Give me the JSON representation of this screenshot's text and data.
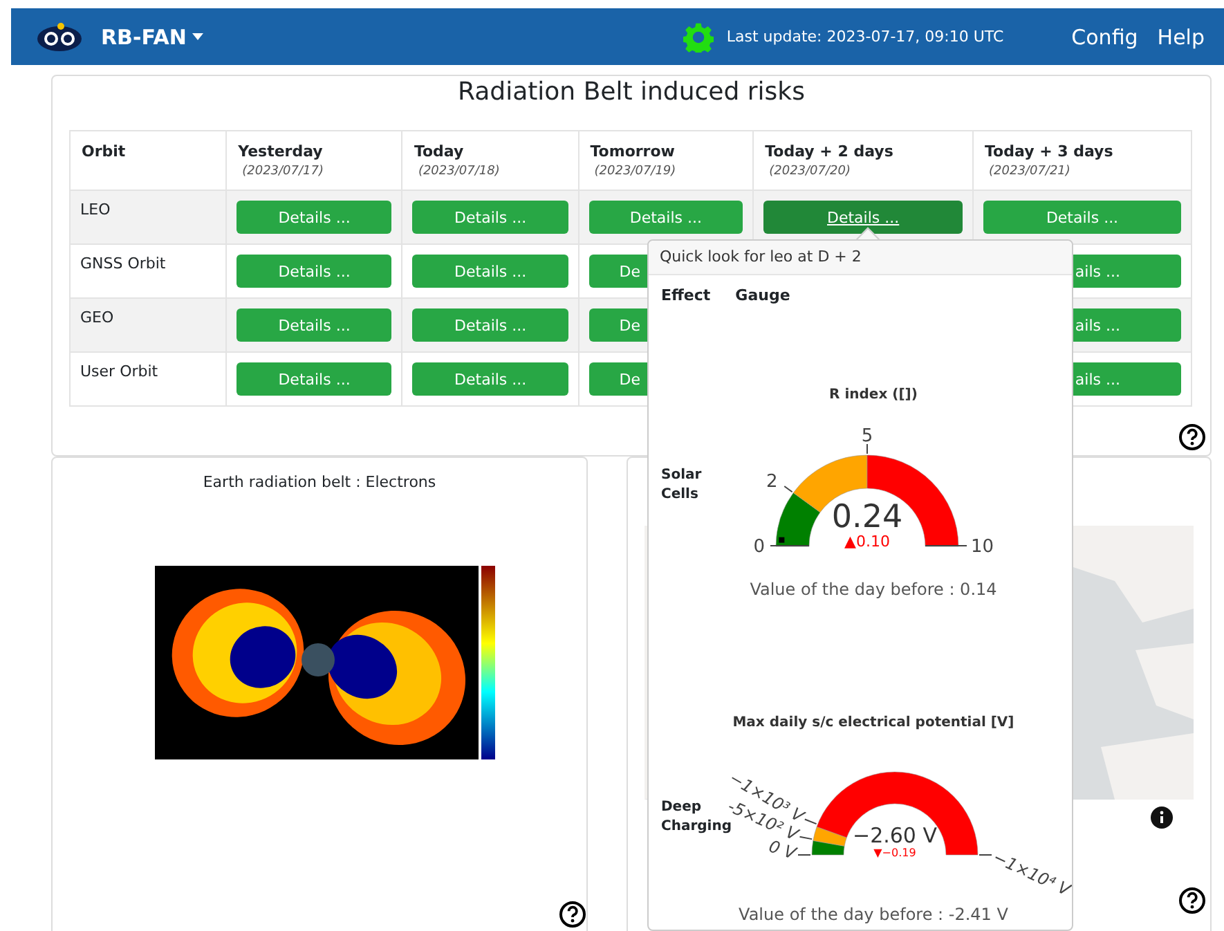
{
  "navbar": {
    "brand": "RB-FAN",
    "last_update": "Last update: 2023-07-17, 09:10 UTC",
    "links": [
      "Config",
      "Help"
    ]
  },
  "risks": {
    "title": "Radiation Belt induced risks",
    "columns": [
      {
        "label": "Orbit"
      },
      {
        "label": "Yesterday",
        "date": "(2023/07/17)"
      },
      {
        "label": "Today",
        "date": "(2023/07/18)"
      },
      {
        "label": "Tomorrow",
        "date": "(2023/07/19)"
      },
      {
        "label": "Today + 2 days",
        "date": "(2023/07/20)"
      },
      {
        "label": "Today + 3 days",
        "date": "(2023/07/21)"
      }
    ],
    "rows": [
      {
        "cells": [
          {
            "kind": "label",
            "label": "LEO"
          },
          {
            "label": "Details ...",
            "selected": false
          },
          {
            "label": "Details ...",
            "selected": false
          },
          {
            "label": "Details ...",
            "selected": false
          },
          {
            "label": "Details ...",
            "selected": true
          },
          {
            "label": "Details ...",
            "selected": false
          }
        ]
      },
      {
        "cells": [
          {
            "kind": "label",
            "label": "GNSS Orbit"
          },
          {
            "label": "Details ...",
            "selected": false
          },
          {
            "label": "Details ...",
            "selected": false
          },
          {
            "kind": "cut-end",
            "label": "De",
            "selected": false
          },
          {},
          {
            "kind": "cut-start",
            "label": "ails ...",
            "selected": false
          }
        ]
      },
      {
        "cells": [
          {
            "kind": "label",
            "label": "GEO"
          },
          {
            "label": "Details ...",
            "selected": false
          },
          {
            "label": "Details ...",
            "selected": false
          },
          {
            "kind": "cut-end",
            "label": "De",
            "selected": false
          },
          {},
          {
            "kind": "cut-start",
            "label": "ails ...",
            "selected": false
          }
        ]
      },
      {
        "cells": [
          {
            "kind": "label",
            "label": "User Orbit"
          },
          {
            "label": "Details ...",
            "selected": false
          },
          {
            "label": "Details ...",
            "selected": false
          },
          {
            "kind": "cut-end",
            "label": "De",
            "selected": false
          },
          {},
          {
            "kind": "cut-start",
            "label": "ails ...",
            "selected": false
          }
        ]
      }
    ]
  },
  "belt_panel": {
    "title": "Earth radiation belt : Electrons"
  },
  "popover": {
    "title": "Quick look for leo at D + 2",
    "headers": [
      "Effect",
      "Gauge"
    ],
    "gauges": [
      {
        "kind": "r-index",
        "effect": "Solar Cells",
        "title": "R index ([])",
        "value": "0.24",
        "delta": "▲0.10",
        "ticks": [
          "0",
          "2",
          "5",
          "10"
        ],
        "level": 0.024,
        "day_before": "Value of the day before : 0.14"
      },
      {
        "kind": "potential",
        "effect": "Deep Charging",
        "title": "Max daily s/c electrical potential [V]",
        "value": "−2.60 V",
        "delta": "▼−0.19",
        "ticks": [
          "0 V",
          "-5×10² V",
          "−1×10³ V",
          "−1×10⁴ V"
        ],
        "day_before": "Value of the day before : -2.41 V"
      }
    ]
  }
}
